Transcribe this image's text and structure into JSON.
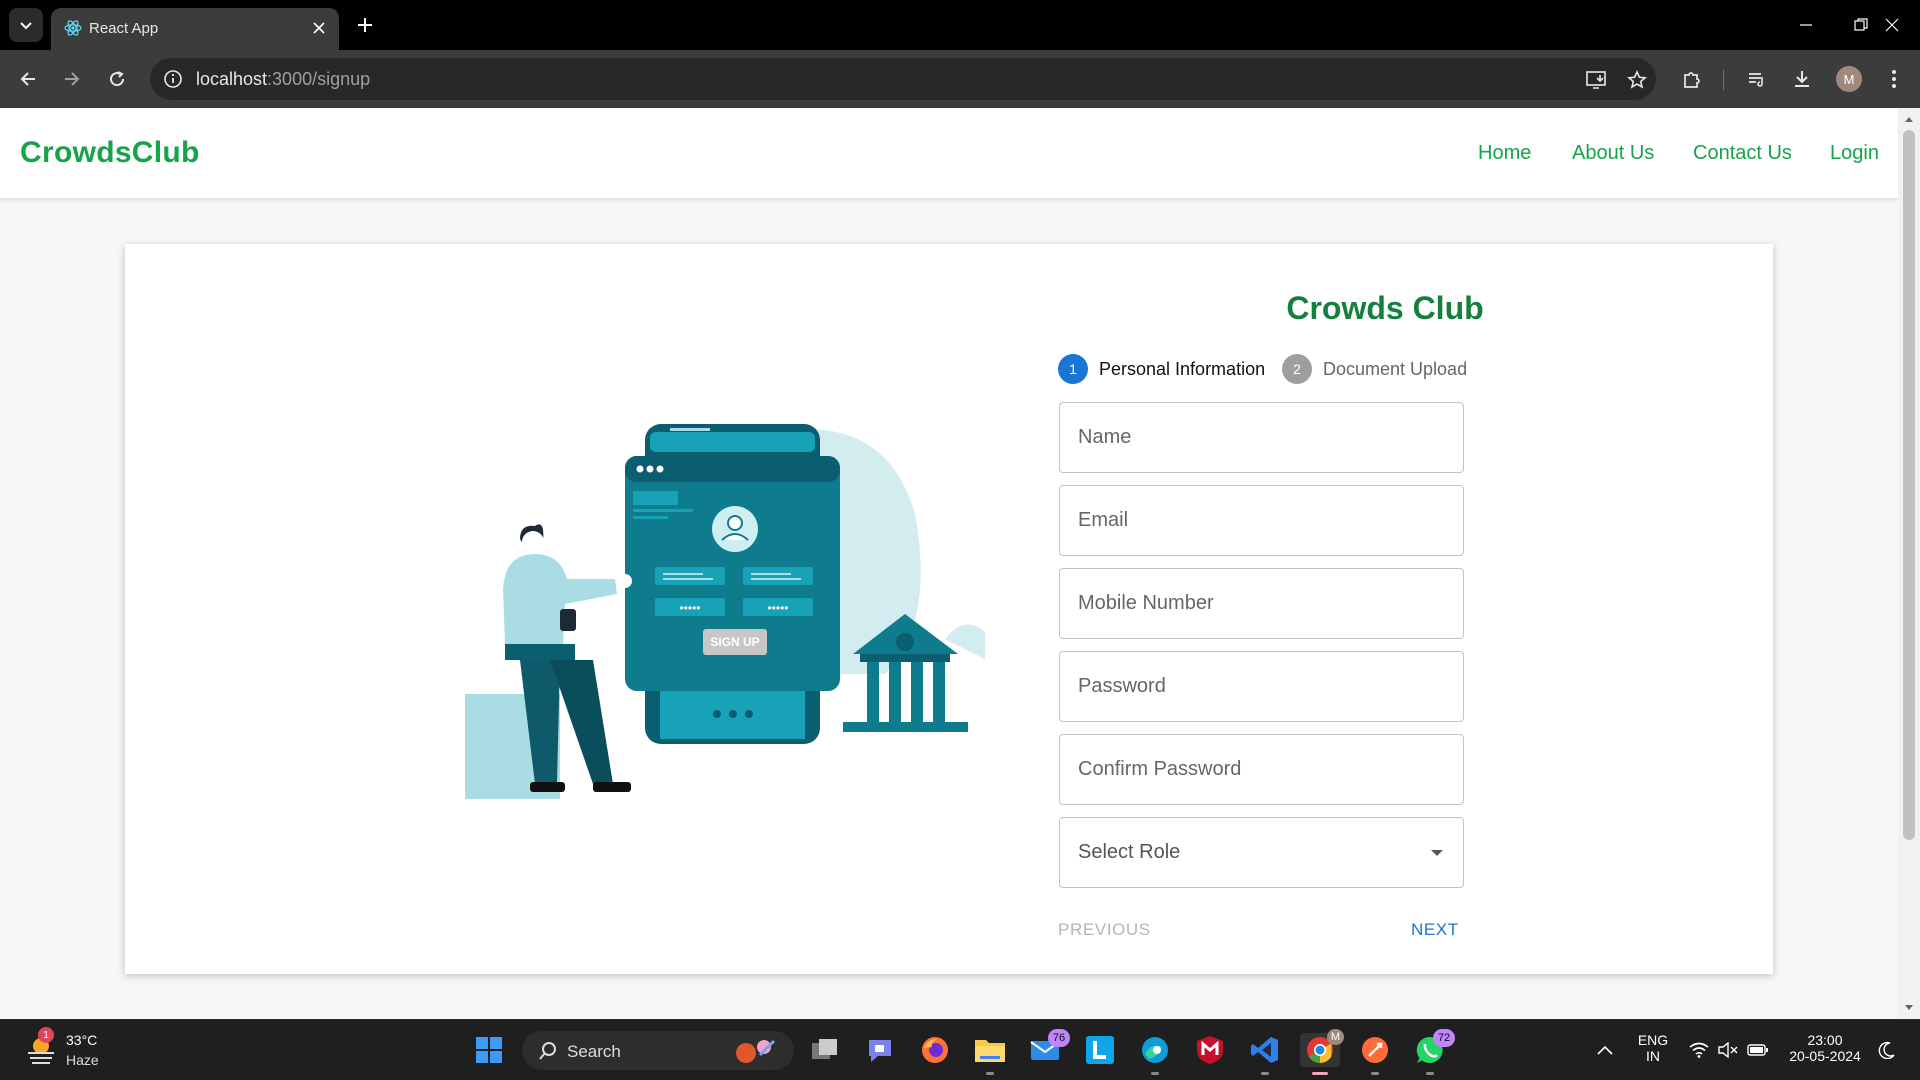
{
  "browser": {
    "tab_title": "React App",
    "url_host": "localhost",
    "url_rest": ":3000/signup",
    "profile_initial": "M",
    "icons": [
      "tab-search-icon",
      "react-favicon-icon",
      "close-icon",
      "plus-icon",
      "minimize-icon",
      "restore-icon",
      "window-close-icon",
      "back-icon",
      "forward-icon",
      "reload-icon",
      "site-info-icon",
      "install-app-icon",
      "star-icon",
      "extensions-icon",
      "media-control-icon",
      "download-icon",
      "more-vert-icon"
    ]
  },
  "navbar": {
    "brand": "CrowdsClub",
    "links": [
      "Home",
      "About Us",
      "Contact Us",
      "Login"
    ],
    "brand_color": "#16a34a"
  },
  "form": {
    "title": "Crowds Club",
    "steps": [
      {
        "number": "1",
        "label": "Personal Information",
        "active": true
      },
      {
        "number": "2",
        "label": "Document Upload",
        "active": false
      }
    ],
    "fields": {
      "name_placeholder": "Name",
      "email_placeholder": "Email",
      "mobile_placeholder": "Mobile Number",
      "password_placeholder": "Password",
      "confirm_placeholder": "Confirm Password",
      "role_placeholder": "Select Role"
    },
    "previous_label": "PREVIOUS",
    "next_label": "NEXT",
    "accent_color": "#1976d2"
  },
  "illustration": {
    "button_text": "SIGN UP",
    "password_mask": "•••••"
  },
  "taskbar": {
    "weather_temp": "33°C",
    "weather_condition": "Haze",
    "weather_badge": "1",
    "search_label": "Search",
    "mail_badge": "76",
    "whatsapp_badge": "72",
    "chrome_profile": "M",
    "language": "ENG",
    "region": "IN",
    "time": "23:00",
    "date": "20-05-2024"
  }
}
